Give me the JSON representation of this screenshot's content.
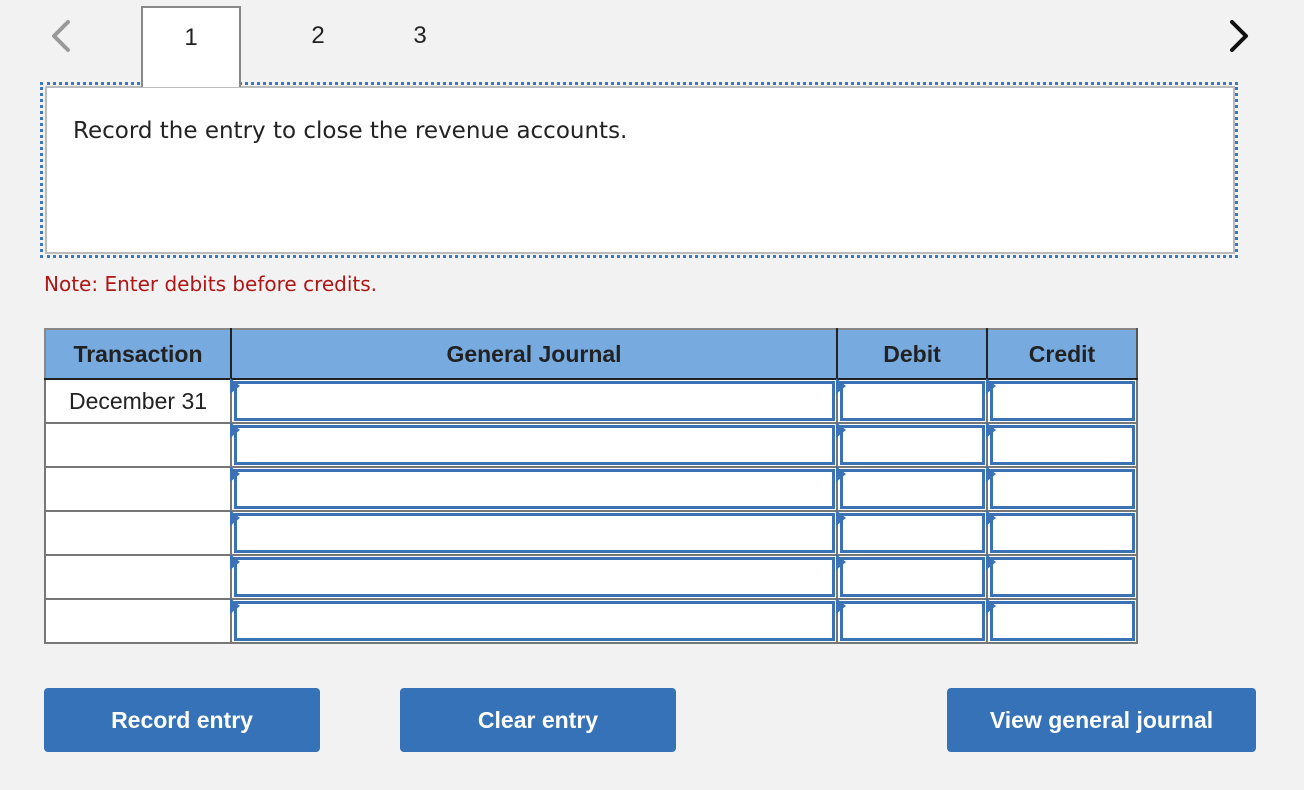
{
  "pager": {
    "prev_icon": "chevron-left-icon",
    "next_icon": "chevron-right-icon",
    "tabs": [
      {
        "label": "1",
        "active": true
      },
      {
        "label": "2",
        "active": false
      },
      {
        "label": "3",
        "active": false
      }
    ]
  },
  "question": {
    "prompt": "Record the entry to close the revenue accounts."
  },
  "note": "Note: Enter debits before credits.",
  "journal": {
    "headers": [
      "Transaction",
      "General Journal",
      "Debit",
      "Credit"
    ],
    "rows": [
      {
        "transaction": "December 31",
        "account": "",
        "debit": "",
        "credit": ""
      },
      {
        "transaction": "",
        "account": "",
        "debit": "",
        "credit": ""
      },
      {
        "transaction": "",
        "account": "",
        "debit": "",
        "credit": ""
      },
      {
        "transaction": "",
        "account": "",
        "debit": "",
        "credit": ""
      },
      {
        "transaction": "",
        "account": "",
        "debit": "",
        "credit": ""
      },
      {
        "transaction": "",
        "account": "",
        "debit": "",
        "credit": ""
      }
    ]
  },
  "buttons": {
    "record": "Record entry",
    "clear": "Clear entry",
    "view": "View general journal"
  },
  "colors": {
    "accent": "#3572b7",
    "header_bg": "#77abe0",
    "note": "#b01515"
  }
}
